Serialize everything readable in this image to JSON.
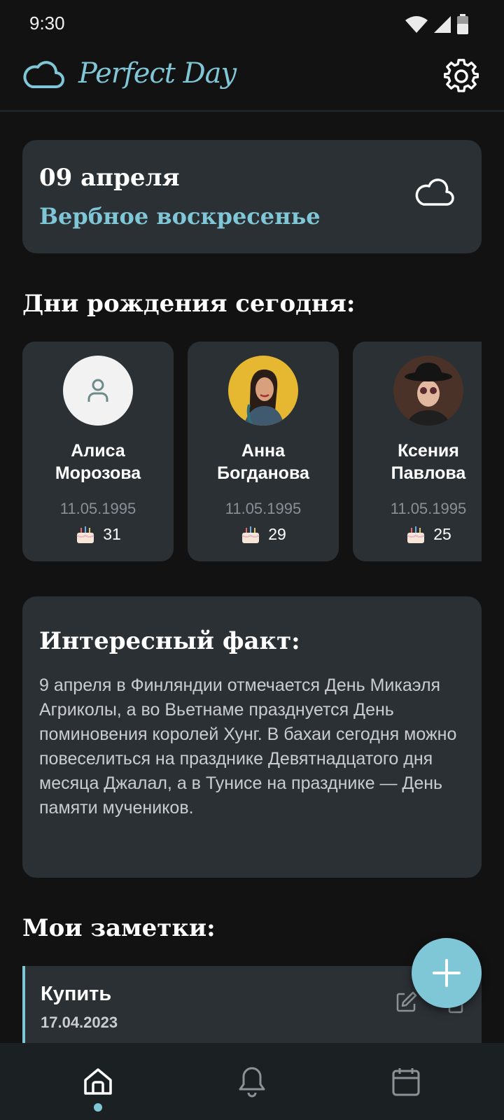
{
  "status_bar": {
    "time": "9:30"
  },
  "app_bar": {
    "title": "Perfect Day"
  },
  "date_card": {
    "date": "09 апреля",
    "holiday": "Вербное воскресенье"
  },
  "birthdays": {
    "title": "Дни рождения сегодня:",
    "items": [
      {
        "name_line1": "Алиса",
        "name_line2": "Морозова",
        "date": "11.05.1995",
        "age": "31",
        "avatar": "placeholder"
      },
      {
        "name_line1": "Анна",
        "name_line2": "Богданова",
        "date": "11.05.1995",
        "age": "29",
        "avatar": "photo"
      },
      {
        "name_line1": "Ксения",
        "name_line2": "Павлова",
        "date": "11.05.1995",
        "age": "25",
        "avatar": "photo"
      }
    ]
  },
  "fact": {
    "title": "Интересный факт:",
    "text": "9 апреля в Финляндии отмечается День Микаэля Агриколы, а во Вьетнаме празднуется День поминовения королей Хунг. В бахаи сегодня можно повеселиться на празднике Девятнадцатого дня месяца Джалал, а в Тунисе на празднике — День памяти мучеников."
  },
  "notes": {
    "title": "Мои заметки:",
    "items": [
      {
        "title": "Купить",
        "date": "17.04.2023"
      }
    ]
  },
  "colors": {
    "accent": "#7fc6d6",
    "card": "#2b3035",
    "background": "#121212"
  },
  "icons": {
    "app_logo": "cloud-icon",
    "settings": "gear-icon",
    "weather": "cloud-icon",
    "age": "cake-icon",
    "edit": "edit-icon",
    "delete": "delete-icon",
    "fab": "plus-icon",
    "nav": [
      "home-icon",
      "bell-icon",
      "calendar-icon"
    ]
  }
}
